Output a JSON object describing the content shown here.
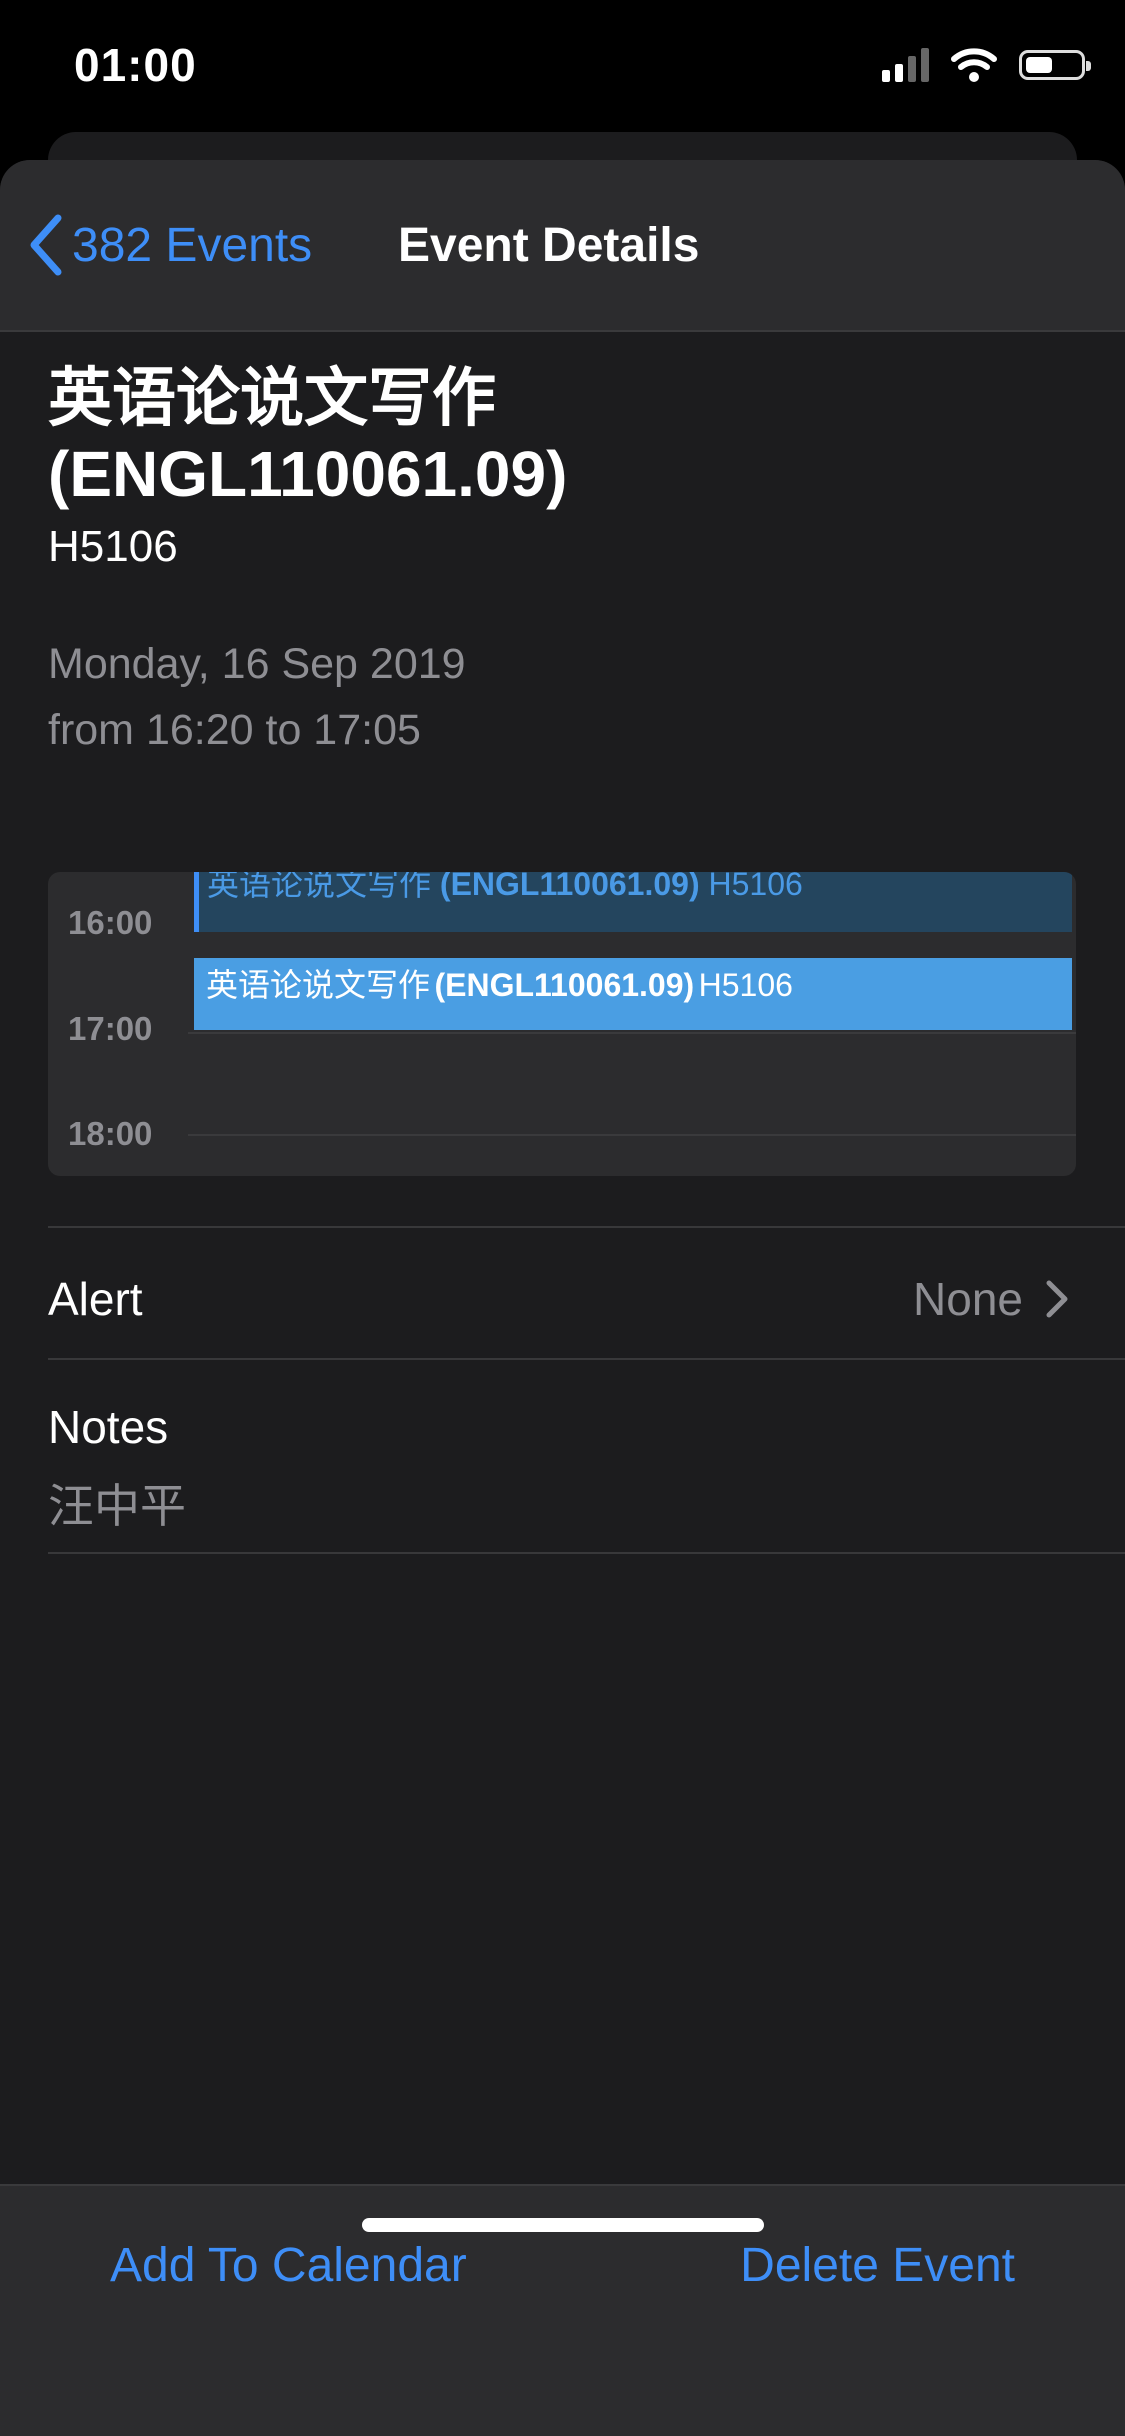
{
  "status_bar": {
    "time": "01:00"
  },
  "nav": {
    "back_label": "382 Events",
    "title": "Event Details"
  },
  "event": {
    "title_line1": "英语论说文写作",
    "title_line2": "(ENGL110061.09)",
    "location": "H5106",
    "date": "Monday, 16 Sep 2019",
    "time_range": "from 16:20 to 17:05"
  },
  "calendar_preview": {
    "hours": [
      "16:00",
      "17:00",
      "18:00"
    ],
    "previous_event": {
      "title": "英语论说文写作",
      "code": "(ENGL110061.09)",
      "room": "H5106"
    },
    "current_event": {
      "title": "英语论说文写作",
      "code": "(ENGL110061.09)",
      "room": "H5106"
    },
    "colors": {
      "current_block": "#4a9ee3",
      "previous_block": "#24455e",
      "accent": "#3e8ef7"
    }
  },
  "alert": {
    "label": "Alert",
    "value": "None"
  },
  "notes": {
    "label": "Notes",
    "value": "汪中平"
  },
  "actions": {
    "add": "Add To Calendar",
    "delete": "Delete Event"
  }
}
